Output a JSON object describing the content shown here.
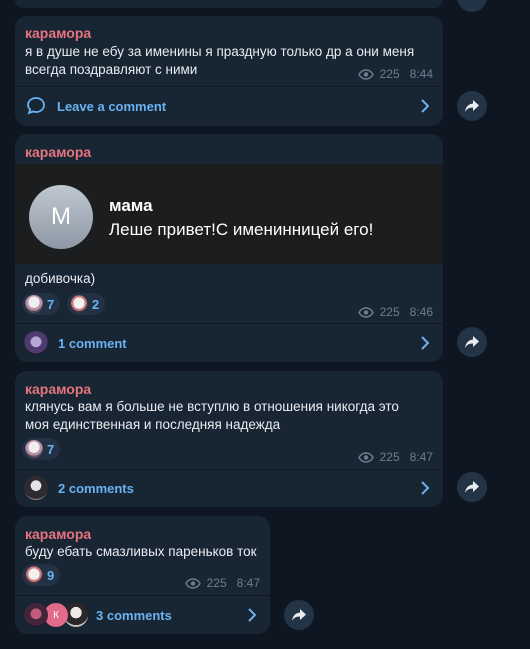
{
  "posts": [
    {
      "author": "карамора",
      "text": "я в душе не ебу за именины я праздную только др а они меня всегда поздравляют с ними",
      "views": "225",
      "time": "8:44",
      "footer": "Leave a comment"
    },
    {
      "author": "карамора",
      "forward": {
        "avatar_letter": "М",
        "name": "мама",
        "message": "Леше привет!С именинницей его!"
      },
      "text": "добивочка)",
      "reactions": [
        {
          "icon": "bunny-sticker-icon",
          "count": "7"
        },
        {
          "icon": "cat-sticker-icon",
          "count": "2"
        }
      ],
      "views": "225",
      "time": "8:46",
      "footer": "1 comment"
    },
    {
      "author": "карамора",
      "text": "клянусь вам я больше не вступлю в отношения никогда это моя единственная и последняя надежда",
      "reactions": [
        {
          "icon": "bunny-sticker-icon",
          "count": "7"
        }
      ],
      "views": "225",
      "time": "8:47",
      "footer": "2 comments"
    },
    {
      "author": "карамора",
      "text": "буду ебать смазливых пареньков ток",
      "reactions": [
        {
          "icon": "cat-sticker-icon",
          "count": "9"
        }
      ],
      "views": "225",
      "time": "8:47",
      "footer": "3 comments",
      "commenter_letter": "К"
    }
  ],
  "colors": {
    "background": "#0e1621",
    "bubble": "#182533",
    "author": "#e5747f",
    "link": "#6ab2f2",
    "meta": "#6d7f8f"
  }
}
